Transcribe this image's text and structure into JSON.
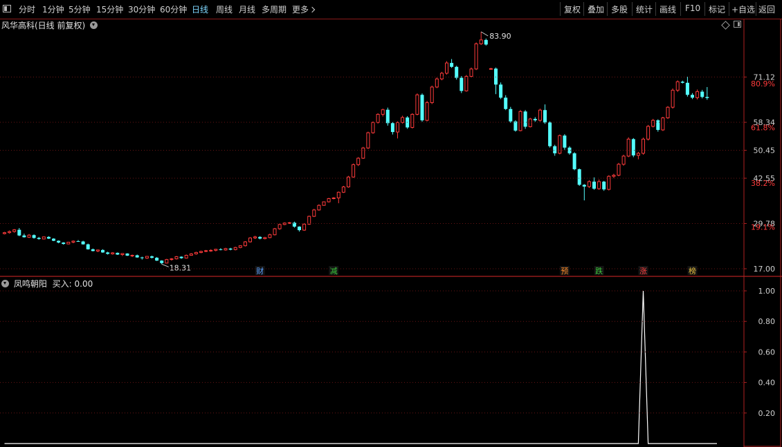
{
  "toolbar": {
    "periods": [
      "分时",
      "1分钟",
      "5分钟",
      "15分钟",
      "30分钟",
      "60分钟",
      "日线",
      "周线",
      "月线",
      "多周期",
      "更多"
    ],
    "active_period": "日线",
    "more_icon": "chevron-right-icon",
    "right_buttons": [
      "复权",
      "叠加",
      "多股",
      "统计",
      "画线",
      "F10",
      "标记",
      "+自选",
      "返回"
    ]
  },
  "main_chart": {
    "title": "风华高科(日线 前复权)",
    "top_right_icons": [
      "diamond-icon",
      "window-toggle-icon"
    ]
  },
  "indicator": {
    "name": "凤鸣朝阳",
    "label": "买入: 0.00"
  },
  "colors": {
    "up": "#ff3b3b",
    "down": "#54ffff",
    "axis": "#b02020",
    "grid": "#6a1515",
    "active": "#7fd8ff"
  },
  "chart_data": [
    {
      "type": "candlestick",
      "title": "风华高科(日线 前复权)",
      "price_axis_labels": [
        "71.12",
        "58.34",
        "50.45",
        "42.55",
        "29.78",
        "17.00"
      ],
      "percent_axis_labels": [
        {
          "label": "80.9%",
          "price": 69.3
        },
        {
          "label": "61.8%",
          "price": 56.9
        },
        {
          "label": "38.2%",
          "price": 41.2
        },
        {
          "label": "19.1%",
          "price": 28.8
        }
      ],
      "ylim": [
        17.0,
        83.9
      ],
      "max_label": "83.90",
      "min_label": "18.31",
      "event_markers": [
        {
          "text": "财",
          "bar": 52,
          "color": "#5aa0ff"
        },
        {
          "text": "减",
          "bar": 67,
          "color": "#3cc83c"
        },
        {
          "text": "预",
          "bar": 114,
          "color": "#ff8c2a"
        },
        {
          "text": "跌",
          "bar": 121,
          "color": "#3cc83c"
        },
        {
          "text": "涨",
          "bar": 130,
          "color": "#ff4040"
        },
        {
          "text": "榜",
          "bar": 140,
          "color": "#e8c040"
        }
      ],
      "ohlc": [
        [
          26.9,
          27.4,
          26.7,
          27.2
        ],
        [
          27.2,
          27.8,
          26.9,
          27.5
        ],
        [
          27.5,
          28.2,
          27.2,
          28.0
        ],
        [
          28.0,
          28.5,
          26.2,
          26.4
        ],
        [
          26.4,
          26.9,
          25.8,
          25.9
        ],
        [
          25.9,
          26.8,
          25.7,
          26.5
        ],
        [
          26.5,
          26.7,
          25.5,
          25.7
        ],
        [
          25.7,
          26.0,
          25.2,
          25.4
        ],
        [
          25.4,
          26.1,
          25.3,
          26.0
        ],
        [
          26.0,
          26.2,
          25.4,
          25.5
        ],
        [
          25.5,
          25.6,
          24.8,
          24.9
        ],
        [
          24.9,
          25.0,
          24.2,
          24.4
        ],
        [
          24.4,
          24.5,
          23.8,
          24.0
        ],
        [
          24.0,
          24.6,
          23.9,
          24.5
        ],
        [
          24.5,
          25.0,
          24.2,
          24.8
        ],
        [
          24.8,
          25.1,
          24.6,
          24.7
        ],
        [
          24.7,
          24.9,
          23.8,
          23.9
        ],
        [
          23.9,
          24.1,
          22.4,
          22.5
        ],
        [
          22.5,
          22.7,
          21.9,
          22.0
        ],
        [
          22.0,
          22.4,
          21.7,
          22.3
        ],
        [
          22.3,
          22.5,
          21.5,
          21.6
        ],
        [
          21.6,
          21.8,
          21.0,
          21.2
        ],
        [
          21.2,
          21.7,
          21.0,
          21.5
        ],
        [
          21.5,
          21.6,
          20.9,
          21.0
        ],
        [
          21.0,
          21.4,
          20.6,
          21.3
        ],
        [
          21.3,
          21.4,
          20.6,
          20.7
        ],
        [
          20.7,
          21.0,
          20.3,
          20.8
        ],
        [
          20.8,
          21.0,
          20.1,
          20.2
        ],
        [
          20.2,
          20.4,
          19.6,
          20.0
        ],
        [
          20.0,
          20.6,
          19.8,
          20.5
        ],
        [
          20.5,
          20.7,
          19.9,
          20.1
        ],
        [
          20.1,
          20.3,
          19.2,
          19.3
        ],
        [
          19.3,
          19.4,
          18.31,
          18.6
        ],
        [
          18.6,
          19.8,
          18.5,
          19.6
        ],
        [
          19.6,
          20.0,
          19.3,
          19.8
        ],
        [
          19.8,
          20.6,
          19.6,
          20.4
        ],
        [
          20.4,
          20.5,
          19.8,
          20.0
        ],
        [
          20.0,
          21.0,
          19.9,
          20.8
        ],
        [
          20.8,
          21.4,
          20.7,
          21.2
        ],
        [
          21.2,
          21.8,
          21.0,
          21.6
        ],
        [
          21.6,
          22.1,
          21.4,
          21.9
        ],
        [
          21.9,
          22.3,
          21.7,
          22.1
        ],
        [
          22.1,
          22.5,
          21.8,
          22.2
        ],
        [
          22.2,
          22.6,
          21.9,
          22.5
        ],
        [
          22.5,
          22.8,
          22.2,
          22.3
        ],
        [
          22.3,
          22.9,
          22.1,
          22.7
        ],
        [
          22.7,
          22.9,
          22.2,
          22.4
        ],
        [
          22.4,
          23.2,
          22.2,
          23.0
        ],
        [
          23.0,
          23.6,
          22.8,
          23.5
        ],
        [
          23.5,
          24.8,
          23.3,
          24.6
        ],
        [
          24.6,
          25.9,
          24.4,
          25.7
        ],
        [
          25.7,
          26.3,
          25.4,
          26.0
        ],
        [
          26.0,
          26.2,
          25.3,
          25.5
        ],
        [
          25.5,
          26.0,
          25.3,
          25.8
        ],
        [
          25.8,
          26.9,
          25.6,
          26.6
        ],
        [
          26.6,
          28.5,
          26.4,
          28.3
        ],
        [
          28.3,
          29.7,
          28.0,
          29.5
        ],
        [
          29.5,
          30.1,
          29.3,
          29.9
        ],
        [
          29.9,
          30.2,
          29.7,
          30.0
        ],
        [
          30.0,
          30.3,
          28.6,
          28.9
        ],
        [
          28.9,
          29.0,
          27.5,
          27.9
        ],
        [
          27.9,
          29.8,
          27.7,
          29.6
        ],
        [
          29.6,
          32.0,
          29.4,
          31.8
        ],
        [
          31.8,
          33.9,
          31.6,
          33.6
        ],
        [
          33.6,
          35.2,
          33.4,
          34.9
        ],
        [
          34.9,
          36.0,
          34.8,
          35.9
        ],
        [
          35.9,
          37.0,
          35.7,
          36.8
        ],
        [
          36.8,
          37.2,
          36.6,
          37.0
        ],
        [
          37.0,
          38.8,
          35.5,
          38.6
        ],
        [
          38.6,
          40.4,
          38.4,
          40.1
        ],
        [
          40.1,
          43.2,
          39.9,
          42.9
        ],
        [
          42.9,
          46.7,
          42.7,
          46.4
        ],
        [
          46.4,
          48.5,
          46.0,
          48.2
        ],
        [
          48.2,
          51.4,
          48.0,
          51.1
        ],
        [
          51.1,
          55.7,
          50.8,
          55.4
        ],
        [
          55.4,
          58.6,
          55.1,
          58.3
        ],
        [
          58.3,
          60.9,
          58.0,
          60.6
        ],
        [
          60.6,
          62.2,
          60.0,
          61.9
        ],
        [
          61.9,
          62.5,
          57.4,
          58.1
        ],
        [
          58.1,
          58.4,
          54.9,
          55.6
        ],
        [
          55.6,
          58.6,
          53.8,
          58.3
        ],
        [
          58.3,
          60.2,
          58.0,
          59.7
        ],
        [
          59.7,
          60.1,
          56.5,
          56.9
        ],
        [
          56.9,
          60.9,
          56.6,
          60.6
        ],
        [
          60.6,
          66.5,
          60.3,
          66.1
        ],
        [
          66.1,
          66.5,
          58.5,
          58.9
        ],
        [
          58.9,
          64.4,
          58.6,
          63.9
        ],
        [
          63.9,
          68.7,
          63.5,
          68.3
        ],
        [
          68.3,
          71.0,
          68.0,
          70.6
        ],
        [
          70.6,
          72.6,
          70.2,
          72.2
        ],
        [
          72.2,
          75.6,
          71.8,
          75.1
        ],
        [
          75.1,
          76.2,
          73.7,
          74.0
        ],
        [
          74.0,
          74.3,
          70.4,
          70.9
        ],
        [
          70.9,
          71.4,
          66.6,
          67.2
        ],
        [
          67.2,
          71.7,
          67.0,
          71.3
        ],
        [
          71.3,
          73.8,
          71.0,
          73.4
        ],
        [
          73.4,
          80.9,
          73.1,
          80.5
        ],
        [
          80.5,
          83.9,
          80.2,
          81.6
        ],
        [
          81.6,
          82.0,
          80.0,
          80.3
        ],
        [
          73.5,
          73.7,
          73.3,
          73.5
        ],
        [
          73.5,
          73.8,
          66.3,
          69.0
        ],
        [
          69.0,
          69.6,
          64.9,
          65.3
        ],
        [
          65.3,
          66.0,
          61.8,
          62.1
        ],
        [
          62.1,
          62.7,
          58.2,
          58.6
        ],
        [
          58.6,
          58.9,
          55.7,
          56.0
        ],
        [
          56.0,
          61.8,
          55.8,
          61.4
        ],
        [
          61.4,
          61.8,
          56.5,
          57.1
        ],
        [
          57.1,
          59.6,
          56.9,
          59.3
        ],
        [
          59.3,
          59.8,
          58.5,
          58.9
        ],
        [
          58.9,
          62.2,
          58.5,
          61.8
        ],
        [
          61.8,
          63.4,
          57.9,
          58.3
        ],
        [
          58.3,
          58.6,
          51.2,
          51.6
        ],
        [
          51.6,
          52.0,
          48.9,
          49.6
        ],
        [
          49.6,
          54.9,
          49.3,
          54.6
        ],
        [
          54.6,
          55.0,
          50.6,
          51.2
        ],
        [
          51.2,
          51.6,
          49.2,
          49.6
        ],
        [
          49.6,
          49.9,
          44.8,
          45.1
        ],
        [
          45.1,
          45.3,
          40.4,
          40.7
        ],
        [
          40.7,
          40.9,
          36.3,
          40.2
        ],
        [
          40.2,
          42.0,
          39.8,
          41.6
        ],
        [
          41.6,
          42.8,
          39.3,
          39.6
        ],
        [
          39.6,
          42.2,
          39.3,
          41.6
        ],
        [
          41.6,
          41.8,
          39.0,
          39.4
        ],
        [
          39.4,
          43.4,
          39.1,
          43.1
        ],
        [
          43.1,
          43.8,
          42.6,
          43.4
        ],
        [
          43.4,
          46.9,
          43.1,
          46.5
        ],
        [
          46.5,
          49.2,
          46.1,
          48.8
        ],
        [
          48.8,
          54.1,
          48.5,
          53.6
        ],
        [
          53.6,
          53.9,
          48.5,
          49.0
        ],
        [
          49.0,
          50.0,
          47.9,
          49.6
        ],
        [
          49.6,
          54.0,
          49.2,
          53.6
        ],
        [
          53.6,
          57.6,
          53.2,
          57.2
        ],
        [
          57.2,
          59.3,
          56.9,
          58.9
        ],
        [
          58.9,
          59.2,
          55.7,
          56.2
        ],
        [
          56.2,
          59.9,
          55.9,
          59.6
        ],
        [
          59.6,
          62.9,
          59.3,
          62.6
        ],
        [
          62.6,
          67.9,
          62.2,
          67.4
        ],
        [
          67.4,
          70.2,
          66.9,
          69.8
        ],
        [
          69.8,
          70.1,
          69.3,
          69.5
        ],
        [
          69.5,
          71.2,
          65.6,
          66.1
        ],
        [
          66.1,
          66.6,
          64.9,
          65.3
        ],
        [
          65.3,
          67.6,
          64.8,
          67.0
        ],
        [
          67.0,
          67.5,
          65.1,
          65.5
        ],
        [
          65.5,
          68.3,
          64.7,
          65.2
        ]
      ]
    },
    {
      "type": "line",
      "title": "凤鸣朝阳",
      "series": [
        {
          "name": "买入",
          "values": [
            0,
            0,
            0,
            0,
            0,
            0,
            0,
            0,
            0,
            0,
            0,
            0,
            0,
            0,
            0,
            0,
            0,
            0,
            0,
            0,
            0,
            0,
            0,
            0,
            0,
            0,
            0,
            0,
            0,
            0,
            0,
            0,
            0,
            0,
            0,
            0,
            0,
            0,
            0,
            0,
            0,
            0,
            0,
            0,
            0,
            0,
            0,
            0,
            0,
            0,
            0,
            0,
            0,
            0,
            0,
            0,
            0,
            0,
            0,
            0,
            0,
            0,
            0,
            0,
            0,
            0,
            0,
            0,
            0,
            0,
            0,
            0,
            0,
            0,
            0,
            0,
            0,
            0,
            0,
            0,
            0,
            0,
            0,
            0,
            0,
            0,
            0,
            0,
            0,
            0,
            0,
            0,
            0,
            0,
            0,
            0,
            0,
            0,
            0,
            0,
            0,
            0,
            0,
            0,
            0,
            0,
            0,
            0,
            0,
            0,
            0,
            0,
            0,
            0,
            0,
            0,
            0,
            0,
            0,
            0,
            0,
            0,
            0,
            0,
            0,
            0,
            0,
            0,
            0,
            0,
            1,
            0,
            0,
            0,
            0,
            0,
            0,
            0,
            0,
            0,
            0,
            0,
            0,
            0,
            0,
            0
          ]
        }
      ],
      "axis_labels": [
        "1.00",
        "0.80",
        "0.60",
        "0.40",
        "0.20"
      ],
      "ylim": [
        0,
        1.0
      ]
    }
  ]
}
